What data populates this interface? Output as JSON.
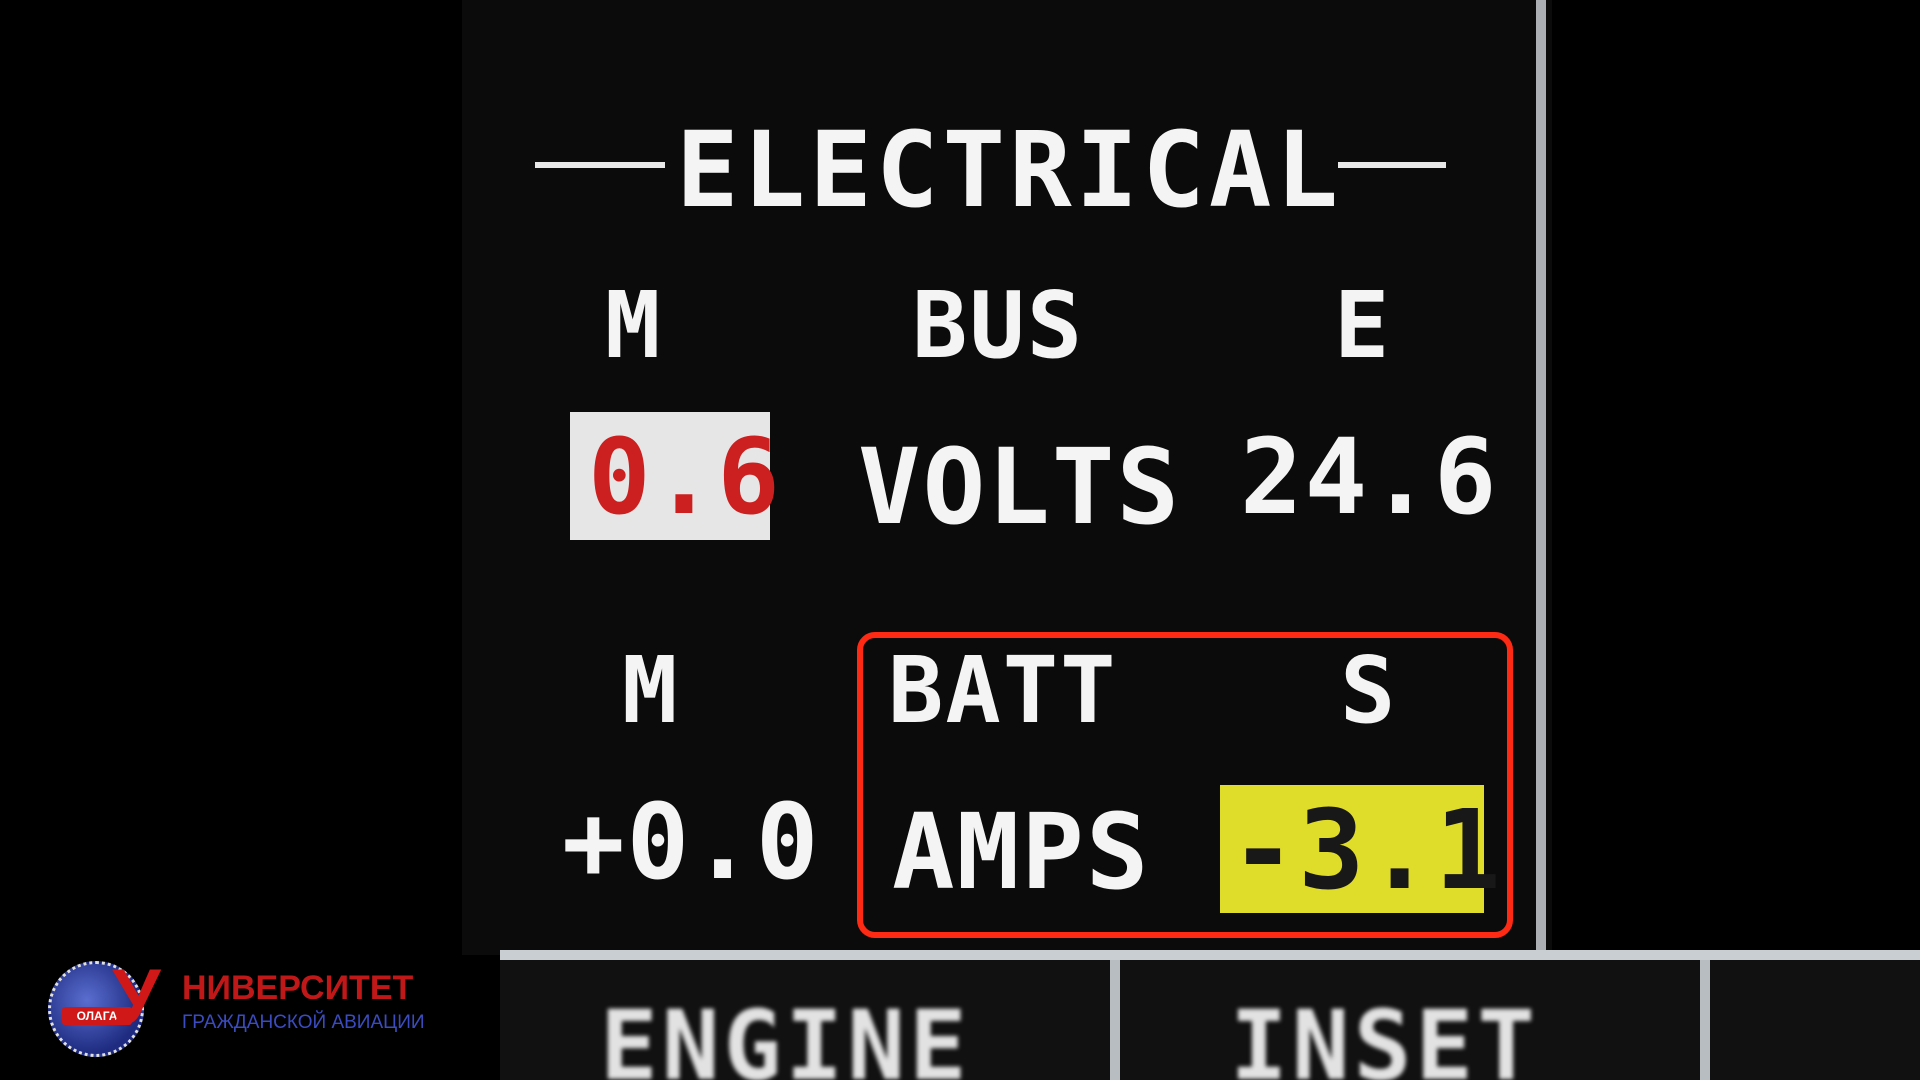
{
  "display": {
    "title": "ELECTRICAL",
    "bus": {
      "left_header": "M",
      "center_header": "BUS",
      "right_header": "E",
      "left_value": "0.6",
      "unit": "VOLTS",
      "right_value": "24.6"
    },
    "batt": {
      "left_header": "M",
      "center_header": "BATT",
      "right_header": "S",
      "left_value": "+0.0",
      "unit": "AMPS",
      "right_value": "-3.1"
    },
    "tabs": [
      "ENGINE",
      "INSET"
    ]
  },
  "colors": {
    "caution_red": "#cc2020",
    "caution_yellow": "#e0dc2a",
    "highlight_frame": "#ff2a14"
  },
  "logo": {
    "letter": "У",
    "name": "НИВЕРСИТЕТ",
    "subtitle": "ГРАЖДАНСКОЙ АВИАЦИИ",
    "badge": "ОЛАГА"
  }
}
